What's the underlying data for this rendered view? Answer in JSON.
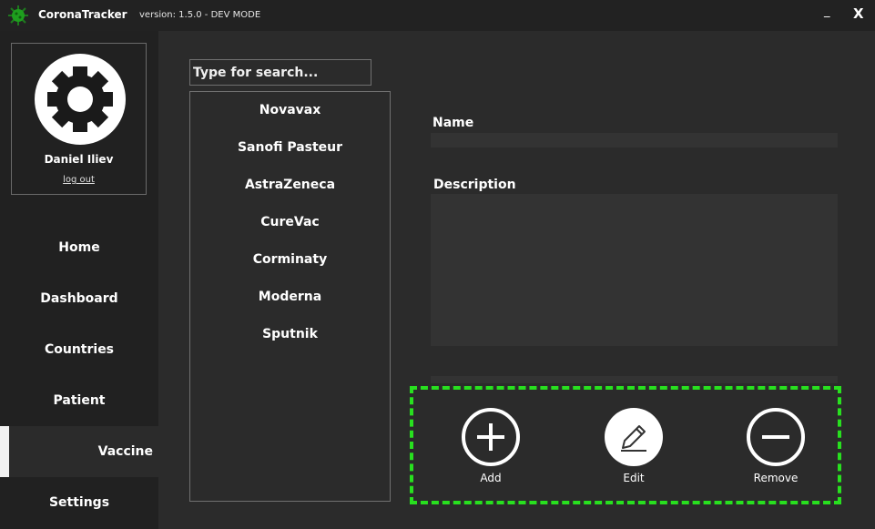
{
  "titlebar": {
    "title": "CoronaTracker",
    "version": "version: 1.5.0 - DEV MODE",
    "minimize_label": "_",
    "close_label": "X"
  },
  "profile": {
    "user_name": "Daniel Iliev",
    "logout_label": "log out"
  },
  "sidebar": {
    "items": [
      {
        "label": "Home",
        "active": false
      },
      {
        "label": "Dashboard",
        "active": false
      },
      {
        "label": "Countries",
        "active": false
      },
      {
        "label": "Patient",
        "active": false
      },
      {
        "label": "Vaccine",
        "active": true
      },
      {
        "label": "Settings",
        "active": false
      }
    ]
  },
  "search": {
    "placeholder": "Type for search..."
  },
  "vaccines": [
    "Novavax",
    "Sanofi Pasteur",
    "AstraZeneca",
    "CureVac",
    "Corminaty",
    "Moderna",
    "Sputnik"
  ],
  "form": {
    "name_label": "Name",
    "name_value": "",
    "description_label": "Description",
    "description_value": ""
  },
  "actions": {
    "add_label": "Add",
    "edit_label": "Edit",
    "remove_label": "Remove"
  },
  "colors": {
    "background": "#2b2b2b",
    "sidebar": "#212121",
    "titlebar": "#222222",
    "highlight_border": "#28e01f",
    "logo_green": "#1e9e1e"
  },
  "icons": {
    "logo": "virus-icon",
    "avatar": "gear-icon",
    "add": "plus-circle-icon",
    "edit": "pencil-icon",
    "remove": "minus-circle-icon"
  }
}
